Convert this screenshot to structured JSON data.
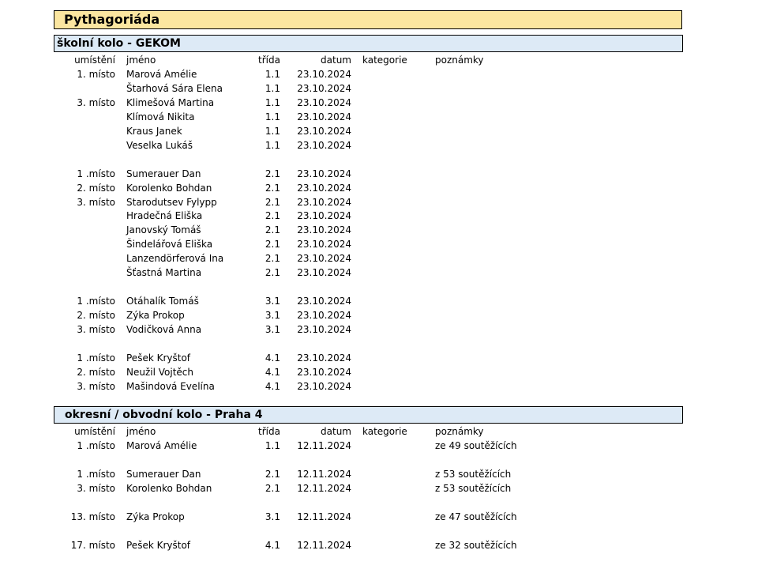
{
  "title": "Pythagoriáda",
  "sections": [
    {
      "heading": "školní kolo - GEKOM",
      "columns": {
        "place": "umístění",
        "name": "jméno",
        "class": "třída",
        "date": "datum",
        "category": "kategorie",
        "notes": "poznámky"
      },
      "rows": [
        {
          "place": "1. místo",
          "name": "Marová Amélie",
          "class": "1.1",
          "date": "23.10.2024",
          "category": "",
          "notes": ""
        },
        {
          "place": "",
          "name": "Štarhová Sára Elena",
          "class": "1.1",
          "date": "23.10.2024",
          "category": "",
          "notes": ""
        },
        {
          "place": "3. místo",
          "name": "Klimešová Martina",
          "class": "1.1",
          "date": "23.10.2024",
          "category": "",
          "notes": ""
        },
        {
          "place": "",
          "name": "Klímová Nikita",
          "class": "1.1",
          "date": "23.10.2024",
          "category": "",
          "notes": ""
        },
        {
          "place": "",
          "name": "Kraus Janek",
          "class": "1.1",
          "date": "23.10.2024",
          "category": "",
          "notes": ""
        },
        {
          "place": "",
          "name": "Veselka Lukáš",
          "class": "1.1",
          "date": "23.10.2024",
          "category": "",
          "notes": ""
        },
        null,
        {
          "place": "1 .místo",
          "name": "Sumerauer Dan",
          "class": "2.1",
          "date": "23.10.2024",
          "category": "",
          "notes": ""
        },
        {
          "place": "2. místo",
          "name": "Korolenko Bohdan",
          "class": "2.1",
          "date": "23.10.2024",
          "category": "",
          "notes": ""
        },
        {
          "place": "3. místo",
          "name": "Starodutsev Fylypp",
          "class": "2.1",
          "date": "23.10.2024",
          "category": "",
          "notes": ""
        },
        {
          "place": "",
          "name": "Hradečná Eliška",
          "class": "2.1",
          "date": "23.10.2024",
          "category": "",
          "notes": ""
        },
        {
          "place": "",
          "name": "Janovský Tomáš",
          "class": "2.1",
          "date": "23.10.2024",
          "category": "",
          "notes": ""
        },
        {
          "place": "",
          "name": "Šindelářová Eliška",
          "class": "2.1",
          "date": "23.10.2024",
          "category": "",
          "notes": ""
        },
        {
          "place": "",
          "name": "Lanzendörferová Ina",
          "class": "2.1",
          "date": "23.10.2024",
          "category": "",
          "notes": ""
        },
        {
          "place": "",
          "name": "Šťastná Martina",
          "class": "2.1",
          "date": "23.10.2024",
          "category": "",
          "notes": ""
        },
        null,
        {
          "place": "1 .místo",
          "name": "Otáhalík Tomáš",
          "class": "3.1",
          "date": "23.10.2024",
          "category": "",
          "notes": ""
        },
        {
          "place": "2. místo",
          "name": "Zýka Prokop",
          "class": "3.1",
          "date": "23.10.2024",
          "category": "",
          "notes": ""
        },
        {
          "place": "3. místo",
          "name": "Vodičková Anna",
          "class": "3.1",
          "date": "23.10.2024",
          "category": "",
          "notes": ""
        },
        null,
        {
          "place": "1 .místo",
          "name": "Pešek Kryštof",
          "class": "4.1",
          "date": "23.10.2024",
          "category": "",
          "notes": ""
        },
        {
          "place": "2. místo",
          "name": "Neužil Vojtěch",
          "class": "4.1",
          "date": "23.10.2024",
          "category": "",
          "notes": ""
        },
        {
          "place": "3. místo",
          "name": "Mašindová Evelína",
          "class": "4.1",
          "date": "23.10.2024",
          "category": "",
          "notes": ""
        }
      ]
    },
    {
      "heading": "okresní / obvodní kolo - Praha 4",
      "columns": {
        "place": "umístění",
        "name": "jméno",
        "class": "třída",
        "date": "datum",
        "category": "kategorie",
        "notes": "poznámky"
      },
      "rows": [
        {
          "place": "1 .místo",
          "name": "Marová Amélie",
          "class": "1.1",
          "date": "12.11.2024",
          "category": "",
          "notes": "ze 49 soutěžících"
        },
        null,
        {
          "place": "1 .místo",
          "name": "Sumerauer Dan",
          "class": "2.1",
          "date": "12.11.2024",
          "category": "",
          "notes": "z 53 soutěžících"
        },
        {
          "place": "3. místo",
          "name": "Korolenko Bohdan",
          "class": "2.1",
          "date": "12.11.2024",
          "category": "",
          "notes": "z 53 soutěžících"
        },
        null,
        {
          "place": "13. místo",
          "name": "Zýka Prokop",
          "class": "3.1",
          "date": "12.11.2024",
          "category": "",
          "notes": "ze 47 soutěžících"
        },
        null,
        {
          "place": "17. místo",
          "name": "Pešek Kryštof",
          "class": "4.1",
          "date": "12.11.2024",
          "category": "",
          "notes": "ze 32 soutěžících"
        }
      ]
    }
  ]
}
